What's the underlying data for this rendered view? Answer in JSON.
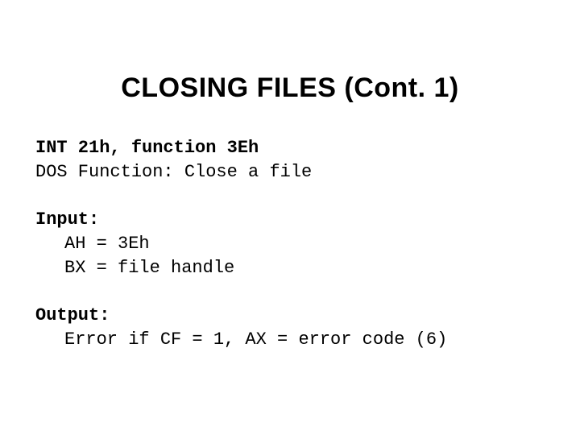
{
  "title": "CLOSING FILES (Cont. 1)",
  "intro": {
    "line1": "INT 21h, function 3Eh",
    "line2": "DOS Function: Close a file"
  },
  "input": {
    "label": "Input:",
    "line1": "AH = 3Eh",
    "line2": "BX = file handle"
  },
  "output": {
    "label": "Output:",
    "line1": "Error if CF = 1, AX = error code (6)"
  }
}
